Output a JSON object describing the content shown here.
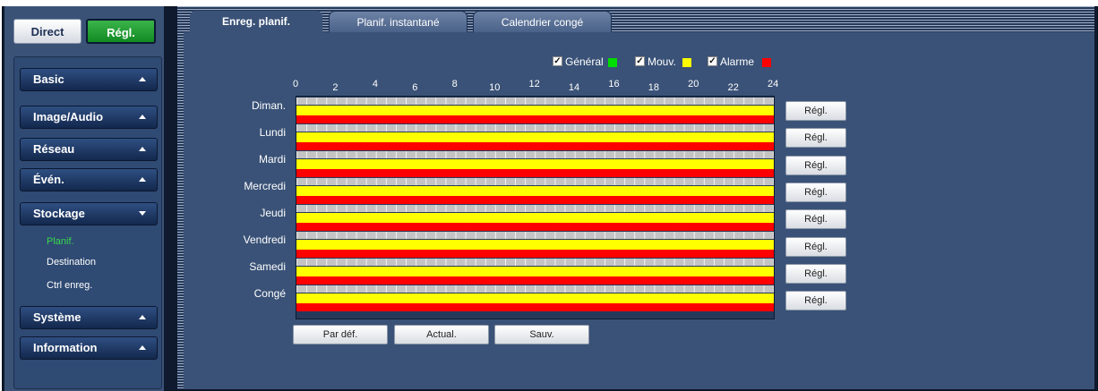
{
  "top_buttons": {
    "direct": "Direct",
    "regl": "Régl."
  },
  "nav": {
    "basic": "Basic",
    "image_audio": "Image/Audio",
    "reseau": "Réseau",
    "even": "Évén.",
    "stockage": "Stockage",
    "stockage_sub": [
      "Planif.",
      "Destination",
      "Ctrl enreg."
    ],
    "systeme": "Système",
    "information": "Information"
  },
  "tabs": [
    "Enreg. planif.",
    "Planif. instantané",
    "Calendrier congé"
  ],
  "legend": [
    {
      "label": "Général",
      "checked": true,
      "color": "#00dd00"
    },
    {
      "label": "Mouv.",
      "checked": true,
      "color": "#ffff00"
    },
    {
      "label": "Alarme",
      "checked": true,
      "color": "#ff0000"
    }
  ],
  "hours": [
    "0",
    "2",
    "4",
    "6",
    "8",
    "10",
    "12",
    "14",
    "16",
    "18",
    "20",
    "22",
    "24"
  ],
  "days": [
    "Diman.",
    "Lundi",
    "Mardi",
    "Mercredi",
    "Jeudi",
    "Vendredi",
    "Samedi",
    "Congé"
  ],
  "set_label": "Régl.",
  "bottom_buttons": {
    "default": "Par déf.",
    "refresh": "Actual.",
    "save": "Sauv."
  }
}
